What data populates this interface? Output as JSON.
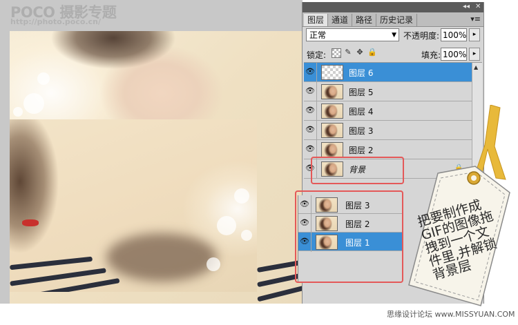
{
  "watermark": {
    "logo": "POCO 摄影专题",
    "url": "http://photo.poco.cn/"
  },
  "panel": {
    "tabs": [
      {
        "label": "图层",
        "active": true
      },
      {
        "label": "通道",
        "active": false
      },
      {
        "label": "路径",
        "active": false
      },
      {
        "label": "历史记录",
        "active": false
      }
    ],
    "topbar_buttons": [
      "◂◂",
      "✕"
    ],
    "menu_icon": "panel-menu-icon",
    "blend_mode": "正常",
    "opacity_label": "不透明度:",
    "opacity_value": "100%",
    "lock_label": "锁定:",
    "lock_icons": [
      "lock-transparent-icon",
      "lock-brush-icon",
      "lock-move-icon",
      "lock-all-icon"
    ],
    "fill_label": "填充:",
    "fill_value": "100%",
    "layers": [
      {
        "name": "图层 6",
        "selected": true,
        "transparent": true
      },
      {
        "name": "图层 5",
        "selected": false,
        "transparent": false
      },
      {
        "name": "图层 4",
        "selected": false,
        "transparent": false
      },
      {
        "name": "图层 3",
        "selected": false,
        "transparent": false
      },
      {
        "name": "图层 2",
        "selected": false,
        "transparent": false
      },
      {
        "name": "背景",
        "selected": false,
        "transparent": false,
        "locked": true
      }
    ]
  },
  "panel2": {
    "layers": [
      {
        "name": "图层 3",
        "selected": false
      },
      {
        "name": "图层 2",
        "selected": false
      },
      {
        "name": "图层 1",
        "selected": true
      }
    ]
  },
  "tag": {
    "text": "把要制作成GIF的图像拖拽到一个文件里,并解锁背景层"
  },
  "footer": "思缘设计论坛 www.MISSYUAN.COM",
  "colors": {
    "selection": "#3a8fd6",
    "highlight_box": "#e45858",
    "panel_bg": "#d6d6d6"
  }
}
